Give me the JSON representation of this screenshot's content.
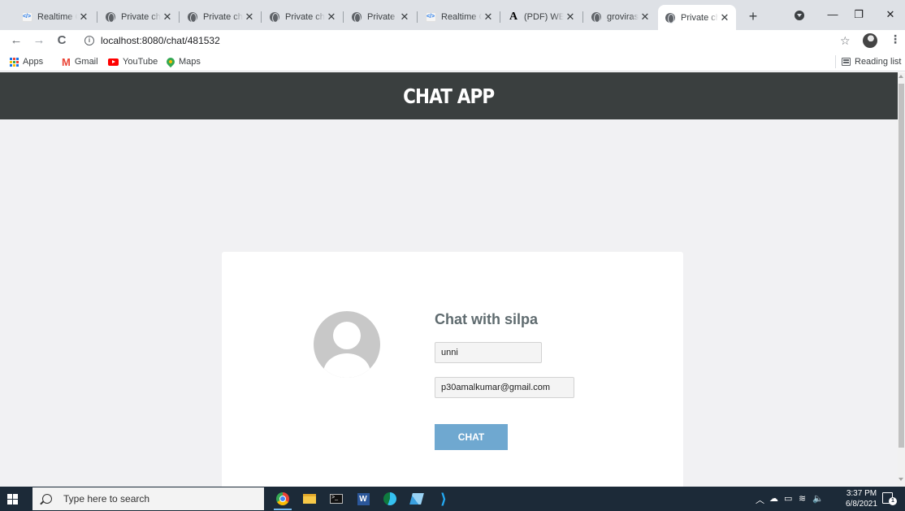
{
  "browser": {
    "tabs": [
      {
        "title": "Realtime C",
        "icon": "code-icon",
        "active": false
      },
      {
        "title": "Private cha",
        "icon": "globe-icon",
        "active": false
      },
      {
        "title": "Private cha",
        "icon": "globe-icon",
        "active": false
      },
      {
        "title": "Private cha",
        "icon": "globe-icon",
        "active": false
      },
      {
        "title": "Private cha",
        "icon": "globe-icon",
        "active": false
      },
      {
        "title": "Realtime C",
        "icon": "code-icon",
        "active": false
      },
      {
        "title": "(PDF) WEB",
        "icon": "a-letter-icon",
        "active": false
      },
      {
        "title": "groviras.pc",
        "icon": "globe-icon",
        "active": false
      },
      {
        "title": "Private cha",
        "icon": "globe-icon",
        "active": true
      }
    ],
    "tab_close_glyph": "✕",
    "new_tab_glyph": "+",
    "window_controls": {
      "minimize": "—",
      "restore": "❐",
      "close": "✕"
    },
    "url": "localhost:8080/chat/481532",
    "bookmarks": [
      {
        "label": "Apps",
        "icon": "apps-grid-icon"
      },
      {
        "label": "Gmail",
        "icon": "gmail-icon"
      },
      {
        "label": "YouTube",
        "icon": "youtube-icon"
      },
      {
        "label": "Maps",
        "icon": "maps-icon"
      }
    ],
    "reading_list": "Reading list"
  },
  "page": {
    "header_title": "CHAT APP",
    "header_bg": "#3a3f3f",
    "background": "#f1f1f3",
    "card": {
      "heading": "Chat with silpa",
      "username_value": "unni",
      "email_value": "p30amalkumar@gmail.com",
      "chat_button_label": "CHAT",
      "button_color": "#6fa8d0"
    }
  },
  "taskbar": {
    "search_placeholder": "Type here to search",
    "apps": [
      "chrome-icon",
      "file-explorer-icon",
      "terminal-icon",
      "word-icon",
      "edge-icon",
      "paint-icon",
      "vscode-icon"
    ],
    "time": "3:37 PM",
    "date": "6/8/2021",
    "notification_count": "1"
  }
}
